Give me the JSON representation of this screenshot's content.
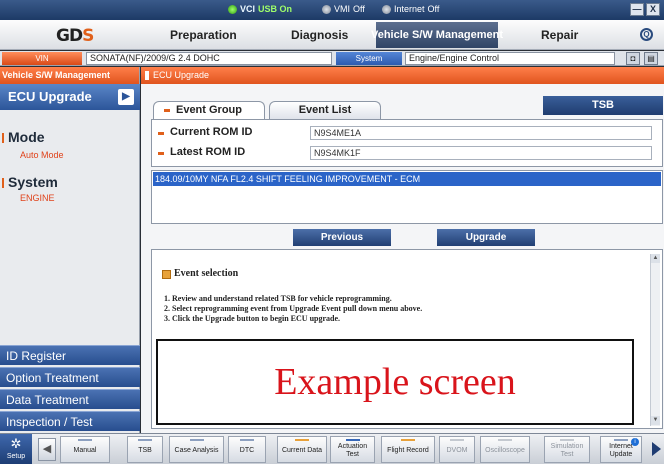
{
  "status_bar": {
    "vci_label": "VCI",
    "usb_status": "USB On",
    "vmi_label": "VMI",
    "vmi_status": "Off",
    "internet_label": "Internet",
    "internet_status": "Off"
  },
  "window_controls": {
    "minimize": "—",
    "close": "X"
  },
  "logo": {
    "text": "GD",
    "accent": "S"
  },
  "main_menu": {
    "items": [
      "Preparation",
      "Diagnosis",
      "Vehicle S/W Management",
      "Repair"
    ],
    "active": "Vehicle S/W Management",
    "search_glyph": "Q"
  },
  "vehicle_bar": {
    "vin_button": "VIN",
    "vehicle": "SONATA(NF)/2009/G 2.4 DOHC",
    "system_button": "System",
    "system_value": "Engine/Engine Control"
  },
  "sidebar": {
    "header": "Vehicle S/W Management",
    "ecu_upgrade": "ECU Upgrade",
    "mode_label": "Mode",
    "mode_value": "Auto Mode",
    "system_label": "System",
    "system_value": "ENGINE",
    "bottom_items": [
      "ID Register",
      "Option Treatment",
      "Data Treatment",
      "Inspection / Test"
    ]
  },
  "content": {
    "header": "ECU Upgrade",
    "tabs": [
      "Event Group",
      "Event List"
    ],
    "tsb_button": "TSB",
    "current_rom_label": "Current ROM ID",
    "current_rom_value": "N9S4ME1A",
    "latest_rom_label": "Latest ROM ID",
    "latest_rom_value": "N9S4MK1F",
    "selected_event": "184.09/10MY NFA FL2.4 SHIFT FEELING IMPROVEMENT - ECM",
    "previous_button": "Previous",
    "upgrade_button": "Upgrade",
    "info_title": "Event selection",
    "steps": [
      "1. Review and understand related TSB for vehicle reprogramming.",
      "2. Select reprogramming event from Upgrade Event pull down menu above.",
      "3. Click the Upgrade button to begin ECU upgrade."
    ],
    "example_text": "Example screen"
  },
  "toolbar": {
    "setup": "Setup",
    "items": [
      "Manual",
      "TSB",
      "Case Analysis",
      "DTC",
      "Current Data",
      "Actuation Test",
      "Flight Record",
      "DVOM",
      "Oscilloscope",
      "Simulation Test",
      "Internet Update"
    ]
  }
}
